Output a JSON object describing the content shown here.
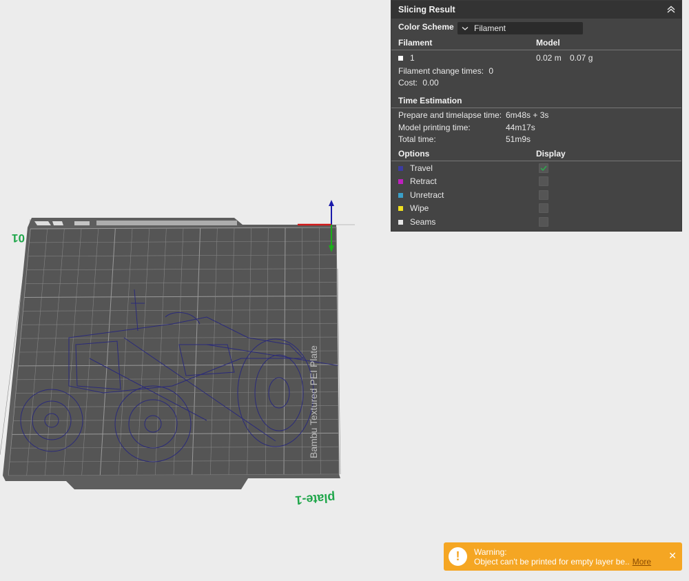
{
  "viewport": {
    "plate_label": "plate-1",
    "corner_label": "01",
    "plate_brand": "Bambu Textured PEI Plate"
  },
  "panel": {
    "title": "Slicing Result",
    "color_scheme_label": "Color Scheme",
    "color_scheme_value": "Filament",
    "filament_header": "Filament",
    "model_header": "Model",
    "filament_row": {
      "id": "1",
      "length": "0.02 m",
      "weight": "0.07 g",
      "color": "#ffffff"
    },
    "filament_change_label": "Filament change times:",
    "filament_change_value": "0",
    "cost_label": "Cost:",
    "cost_value": "0.00",
    "time_header": "Time Estimation",
    "prepare_label": "Prepare and timelapse time:",
    "prepare_value": "6m48s + 3s",
    "model_time_label": "Model printing time:",
    "model_time_value": "44m17s",
    "total_label": "Total time:",
    "total_value": "51m9s",
    "options_header": "Options",
    "display_header": "Display",
    "options": [
      {
        "label": "Travel",
        "color": "#3c3ca0",
        "checked": true
      },
      {
        "label": "Retract",
        "color": "#c020c0",
        "checked": false
      },
      {
        "label": "Unretract",
        "color": "#3aa0c8",
        "checked": false
      },
      {
        "label": "Wipe",
        "color": "#f0e020",
        "checked": false
      },
      {
        "label": "Seams",
        "color": "#e6e6e6",
        "checked": false
      }
    ]
  },
  "toast": {
    "title": "Warning:",
    "message": "Object can't be printed for empty layer be..",
    "more": "More"
  }
}
